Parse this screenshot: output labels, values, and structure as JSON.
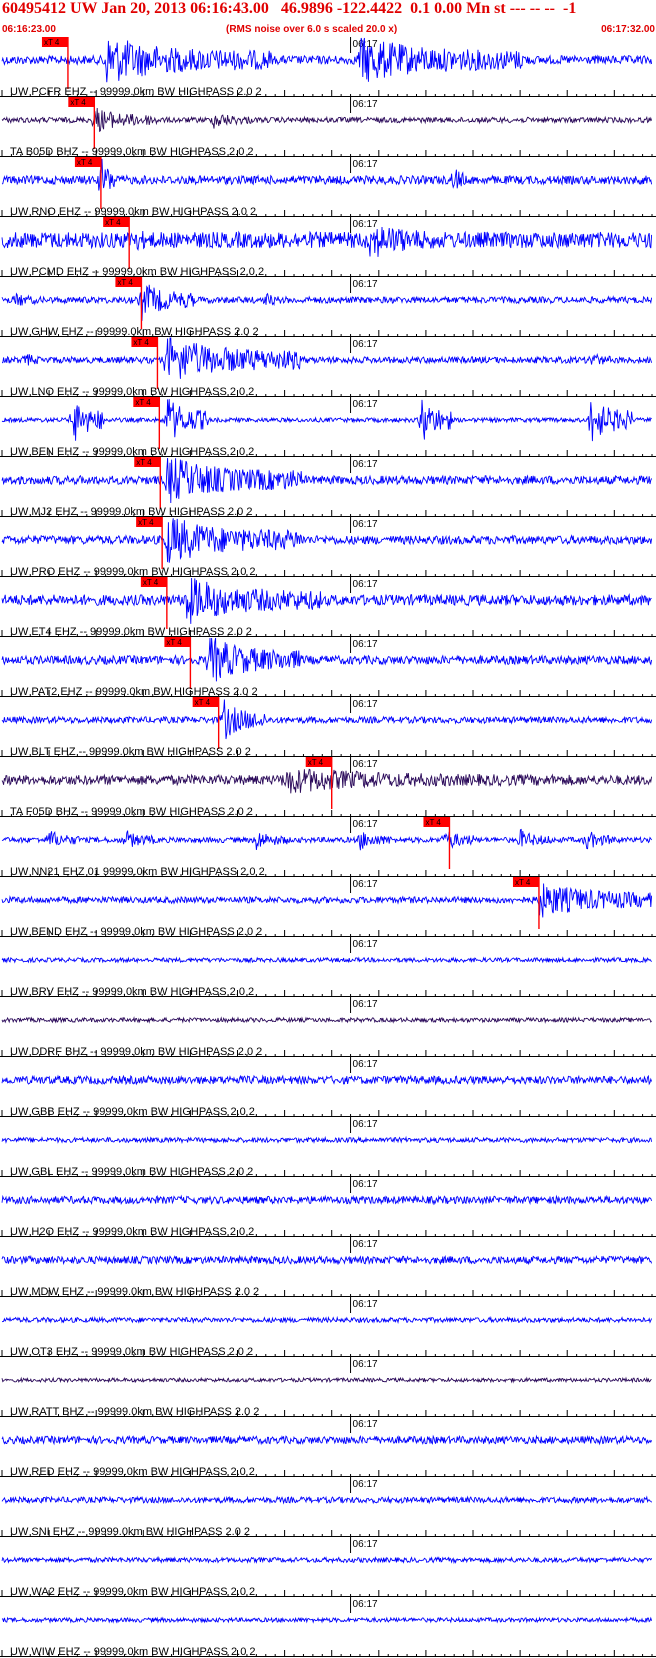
{
  "header": {
    "title": "60495412 UW Jan 20, 2013 06:16:43.00   46.9896 -122.4422  0.1 0.00 Mn st --- -- --  -1",
    "start_time": "06:16:23.00",
    "note": "(RMS noise over 6.0 s scaled 20.0 x)",
    "end_time": "06:17:32.00"
  },
  "colors": {
    "trace_blue": "#0000ff",
    "trace_dark": "#2b0a5a",
    "pick_red": "#ff0000",
    "header_red": "#e00000",
    "axis": "#000000"
  },
  "chart_data": {
    "type": "line",
    "time_range": [
      "06:16:23.00",
      "06:17:32.00"
    ],
    "time_tick_label": "06:17",
    "pick_label": "xT 4",
    "series": [
      {
        "label": "UW PCFR EHZ -- 99999.0km BW  HIGHPASS  2.0  2",
        "color": "blue",
        "noise": 0.16,
        "pick_time": 7.0,
        "bursts": [
          {
            "t": 11.0,
            "dur": 8.0,
            "amp": 1.0
          },
          {
            "t": 38.0,
            "dur": 8.0,
            "amp": 1.0
          }
        ]
      },
      {
        "label": "TA B05D BHZ -- 99999.0km BW  HIGHPASS  2.0  2",
        "color": "dark",
        "noise": 0.1,
        "pick_time": 9.8,
        "bursts": [
          {
            "t": 9.8,
            "dur": 3.0,
            "amp": 0.55
          },
          {
            "t": 22.5,
            "dur": 1.8,
            "amp": 0.4
          }
        ]
      },
      {
        "label": "UW RNO EHZ -- 99999.0km BW  HIGHPASS  2.0  2",
        "color": "blue",
        "noise": 0.16,
        "pick_time": 10.5,
        "bursts": [
          {
            "t": 10.5,
            "dur": 0.8,
            "amp": 1.0
          },
          {
            "t": 48.0,
            "dur": 0.5,
            "amp": 0.75
          }
        ]
      },
      {
        "label": "UW PCMD EHZ -- 99999.0km BW  HIGHPASS  2.0  2",
        "color": "blue",
        "noise": 0.3,
        "pick_time": 13.5,
        "bursts": [
          {
            "t": 13.5,
            "dur": 4.0,
            "amp": 0.5
          },
          {
            "t": 39.0,
            "dur": 6.0,
            "amp": 0.75
          }
        ]
      },
      {
        "label": "UW GHW EHZ -- 99999.0km BW  HIGHPASS  2.0  2",
        "color": "blue",
        "noise": 0.12,
        "pick_time": 14.8,
        "bursts": [
          {
            "t": 14.8,
            "dur": 2.5,
            "amp": 0.8
          },
          {
            "t": 1.5,
            "dur": 1.0,
            "amp": 0.4
          },
          {
            "t": 28.0,
            "dur": 1.0,
            "amp": 0.35
          }
        ]
      },
      {
        "label": "UW LNO EHZ -- 99999.0km BW  HIGHPASS  2.0  2",
        "color": "blue",
        "noise": 0.12,
        "pick_time": 16.5,
        "bursts": [
          {
            "t": 17.5,
            "dur": 6.5,
            "amp": 1.0
          },
          {
            "t": 2.5,
            "dur": 1.0,
            "amp": 0.35
          },
          {
            "t": 62.5,
            "dur": 1.0,
            "amp": 0.4
          }
        ]
      },
      {
        "label": "UW BEN EHZ -- 99999.0km BW  HIGHPASS  2.0  2",
        "color": "blue",
        "noise": 0.08,
        "pick_time": 16.7,
        "bursts": [
          {
            "t": 17.5,
            "dur": 2.0,
            "amp": 1.0
          },
          {
            "t": 7.5,
            "dur": 1.5,
            "amp": 1.0
          },
          {
            "t": 44.5,
            "dur": 1.5,
            "amp": 1.0
          },
          {
            "t": 62.5,
            "dur": 2.0,
            "amp": 1.0
          }
        ]
      },
      {
        "label": "UW MJ2 EHZ -- 99999.0km BW  HIGHPASS  2.0  2",
        "color": "blue",
        "noise": 0.16,
        "pick_time": 16.8,
        "bursts": [
          {
            "t": 17.5,
            "dur": 6.5,
            "amp": 1.0
          }
        ]
      },
      {
        "label": "UW PRO EHZ -- 99999.0km BW  HIGHPASS  2.0  2",
        "color": "blue",
        "noise": 0.16,
        "pick_time": 17.0,
        "bursts": [
          {
            "t": 17.5,
            "dur": 6.5,
            "amp": 1.0
          }
        ]
      },
      {
        "label": "UW ET4 EHZ -- 99999.0km BW  HIGHPASS  2.0  2",
        "color": "blue",
        "noise": 0.2,
        "pick_time": 17.5,
        "bursts": [
          {
            "t": 19.5,
            "dur": 6.5,
            "amp": 1.0
          }
        ]
      },
      {
        "label": "UW PAT2 EHZ -- 99999.0km BW  HIGHPASS  2.0  2",
        "color": "blue",
        "noise": 0.16,
        "pick_time": 20.0,
        "bursts": [
          {
            "t": 22.0,
            "dur": 4.5,
            "amp": 1.0
          }
        ]
      },
      {
        "label": "UW BLT EHZ -- 99999.0km BW  HIGHPASS  2.0  2",
        "color": "blue",
        "noise": 0.12,
        "pick_time": 23.0,
        "bursts": [
          {
            "t": 23.5,
            "dur": 2.0,
            "amp": 0.85
          }
        ]
      },
      {
        "label": "TA F05D BHZ -- 99999.0km BW  HIGHPASS  2.0  2",
        "color": "dark",
        "noise": 0.18,
        "pick_time": 35.0,
        "bursts": [
          {
            "t": 30.0,
            "dur": 14.0,
            "amp": 0.55
          }
        ]
      },
      {
        "label": "UW NN21 EHZ 01 99999.0km BW  HIGHPASS  2.0  2",
        "color": "blue",
        "noise": 0.1,
        "pick_time": 47.5,
        "bursts": [
          {
            "t": 5.0,
            "dur": 1.5,
            "amp": 0.45
          },
          {
            "t": 13.0,
            "dur": 1.5,
            "amp": 0.45
          },
          {
            "t": 27.0,
            "dur": 1.5,
            "amp": 0.45
          },
          {
            "t": 38.0,
            "dur": 1.5,
            "amp": 0.45
          },
          {
            "t": 47.0,
            "dur": 1.5,
            "amp": 0.5
          },
          {
            "t": 55.0,
            "dur": 1.5,
            "amp": 0.45
          },
          {
            "t": 62.0,
            "dur": 1.5,
            "amp": 0.45
          }
        ]
      },
      {
        "label": "UW BEND EHZ -- 99999.0km BW  HIGHPASS  2.0  2",
        "color": "blue",
        "noise": 0.12,
        "pick_time": 57.0,
        "bursts": [
          {
            "t": 57.0,
            "dur": 8.0,
            "amp": 0.7
          }
        ]
      },
      {
        "label": "UW BRV EHZ -- 99999.0km BW  HIGHPASS  2.0  2",
        "color": "blue",
        "noise": 0.08,
        "pick_time": null,
        "bursts": []
      },
      {
        "label": "UW DDRF BHZ -- 99999.0km BW  HIGHPASS  2.0  2",
        "color": "dark",
        "noise": 0.08,
        "pick_time": null,
        "bursts": []
      },
      {
        "label": "UW GBB EHZ -- 99999.0km BW  HIGHPASS  2.0  2",
        "color": "blue",
        "noise": 0.15,
        "pick_time": null,
        "bursts": []
      },
      {
        "label": "UW GBL EHZ -- 99999.0km BW  HIGHPASS  2.0  2",
        "color": "blue",
        "noise": 0.09,
        "pick_time": null,
        "bursts": []
      },
      {
        "label": "UW H2O EHZ -- 99999.0km BW  HIGHPASS  2.0  2",
        "color": "blue",
        "noise": 0.14,
        "pick_time": null,
        "bursts": []
      },
      {
        "label": "UW MDW EHZ -- 99999.0km BW  HIGHPASS  2.0  2",
        "color": "blue",
        "noise": 0.14,
        "pick_time": null,
        "bursts": []
      },
      {
        "label": "UW OT3 EHZ -- 99999.0km BW  HIGHPASS  2.0  2",
        "color": "blue",
        "noise": 0.09,
        "pick_time": null,
        "bursts": []
      },
      {
        "label": "UW RATT BHZ -- 99999.0km BW  HIGHPASS  2.0  2",
        "color": "dark",
        "noise": 0.07,
        "pick_time": null,
        "bursts": []
      },
      {
        "label": "UW RED EHZ -- 99999.0km BW  HIGHPASS  2.0  2",
        "color": "blue",
        "noise": 0.14,
        "pick_time": null,
        "bursts": []
      },
      {
        "label": "UW SNI EHZ -- 99999.0km BW  HIGHPASS  2.0  2",
        "color": "blue",
        "noise": 0.11,
        "pick_time": null,
        "bursts": []
      },
      {
        "label": "UW WA2 EHZ -- 99999.0km BW  HIGHPASS  2.0  2",
        "color": "blue",
        "noise": 0.09,
        "pick_time": null,
        "bursts": []
      },
      {
        "label": "UW WIW EHZ -- 99999.0km BW  HIGHPASS  2.0  2",
        "color": "blue",
        "noise": 0.08,
        "pick_time": null,
        "bursts": []
      }
    ]
  }
}
